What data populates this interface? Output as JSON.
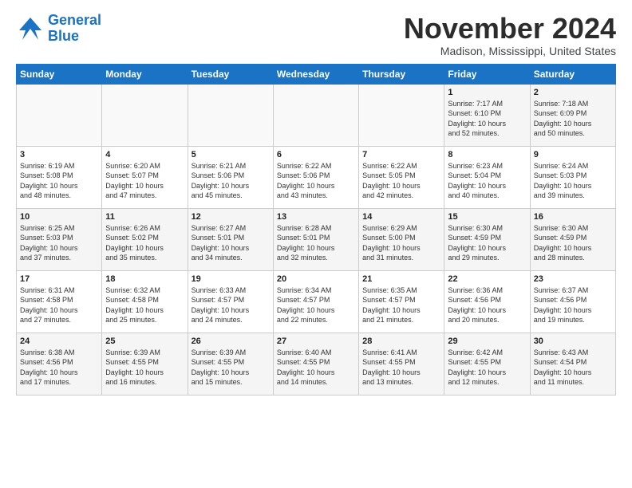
{
  "logo": {
    "line1": "General",
    "line2": "Blue"
  },
  "title": "November 2024",
  "subtitle": "Madison, Mississippi, United States",
  "days_header": [
    "Sunday",
    "Monday",
    "Tuesday",
    "Wednesday",
    "Thursday",
    "Friday",
    "Saturday"
  ],
  "weeks": [
    [
      {
        "day": "",
        "info": ""
      },
      {
        "day": "",
        "info": ""
      },
      {
        "day": "",
        "info": ""
      },
      {
        "day": "",
        "info": ""
      },
      {
        "day": "",
        "info": ""
      },
      {
        "day": "1",
        "info": "Sunrise: 7:17 AM\nSunset: 6:10 PM\nDaylight: 10 hours\nand 52 minutes."
      },
      {
        "day": "2",
        "info": "Sunrise: 7:18 AM\nSunset: 6:09 PM\nDaylight: 10 hours\nand 50 minutes."
      }
    ],
    [
      {
        "day": "3",
        "info": "Sunrise: 6:19 AM\nSunset: 5:08 PM\nDaylight: 10 hours\nand 48 minutes."
      },
      {
        "day": "4",
        "info": "Sunrise: 6:20 AM\nSunset: 5:07 PM\nDaylight: 10 hours\nand 47 minutes."
      },
      {
        "day": "5",
        "info": "Sunrise: 6:21 AM\nSunset: 5:06 PM\nDaylight: 10 hours\nand 45 minutes."
      },
      {
        "day": "6",
        "info": "Sunrise: 6:22 AM\nSunset: 5:06 PM\nDaylight: 10 hours\nand 43 minutes."
      },
      {
        "day": "7",
        "info": "Sunrise: 6:22 AM\nSunset: 5:05 PM\nDaylight: 10 hours\nand 42 minutes."
      },
      {
        "day": "8",
        "info": "Sunrise: 6:23 AM\nSunset: 5:04 PM\nDaylight: 10 hours\nand 40 minutes."
      },
      {
        "day": "9",
        "info": "Sunrise: 6:24 AM\nSunset: 5:03 PM\nDaylight: 10 hours\nand 39 minutes."
      }
    ],
    [
      {
        "day": "10",
        "info": "Sunrise: 6:25 AM\nSunset: 5:03 PM\nDaylight: 10 hours\nand 37 minutes."
      },
      {
        "day": "11",
        "info": "Sunrise: 6:26 AM\nSunset: 5:02 PM\nDaylight: 10 hours\nand 35 minutes."
      },
      {
        "day": "12",
        "info": "Sunrise: 6:27 AM\nSunset: 5:01 PM\nDaylight: 10 hours\nand 34 minutes."
      },
      {
        "day": "13",
        "info": "Sunrise: 6:28 AM\nSunset: 5:01 PM\nDaylight: 10 hours\nand 32 minutes."
      },
      {
        "day": "14",
        "info": "Sunrise: 6:29 AM\nSunset: 5:00 PM\nDaylight: 10 hours\nand 31 minutes."
      },
      {
        "day": "15",
        "info": "Sunrise: 6:30 AM\nSunset: 4:59 PM\nDaylight: 10 hours\nand 29 minutes."
      },
      {
        "day": "16",
        "info": "Sunrise: 6:30 AM\nSunset: 4:59 PM\nDaylight: 10 hours\nand 28 minutes."
      }
    ],
    [
      {
        "day": "17",
        "info": "Sunrise: 6:31 AM\nSunset: 4:58 PM\nDaylight: 10 hours\nand 27 minutes."
      },
      {
        "day": "18",
        "info": "Sunrise: 6:32 AM\nSunset: 4:58 PM\nDaylight: 10 hours\nand 25 minutes."
      },
      {
        "day": "19",
        "info": "Sunrise: 6:33 AM\nSunset: 4:57 PM\nDaylight: 10 hours\nand 24 minutes."
      },
      {
        "day": "20",
        "info": "Sunrise: 6:34 AM\nSunset: 4:57 PM\nDaylight: 10 hours\nand 22 minutes."
      },
      {
        "day": "21",
        "info": "Sunrise: 6:35 AM\nSunset: 4:57 PM\nDaylight: 10 hours\nand 21 minutes."
      },
      {
        "day": "22",
        "info": "Sunrise: 6:36 AM\nSunset: 4:56 PM\nDaylight: 10 hours\nand 20 minutes."
      },
      {
        "day": "23",
        "info": "Sunrise: 6:37 AM\nSunset: 4:56 PM\nDaylight: 10 hours\nand 19 minutes."
      }
    ],
    [
      {
        "day": "24",
        "info": "Sunrise: 6:38 AM\nSunset: 4:56 PM\nDaylight: 10 hours\nand 17 minutes."
      },
      {
        "day": "25",
        "info": "Sunrise: 6:39 AM\nSunset: 4:55 PM\nDaylight: 10 hours\nand 16 minutes."
      },
      {
        "day": "26",
        "info": "Sunrise: 6:39 AM\nSunset: 4:55 PM\nDaylight: 10 hours\nand 15 minutes."
      },
      {
        "day": "27",
        "info": "Sunrise: 6:40 AM\nSunset: 4:55 PM\nDaylight: 10 hours\nand 14 minutes."
      },
      {
        "day": "28",
        "info": "Sunrise: 6:41 AM\nSunset: 4:55 PM\nDaylight: 10 hours\nand 13 minutes."
      },
      {
        "day": "29",
        "info": "Sunrise: 6:42 AM\nSunset: 4:55 PM\nDaylight: 10 hours\nand 12 minutes."
      },
      {
        "day": "30",
        "info": "Sunrise: 6:43 AM\nSunset: 4:54 PM\nDaylight: 10 hours\nand 11 minutes."
      }
    ]
  ]
}
